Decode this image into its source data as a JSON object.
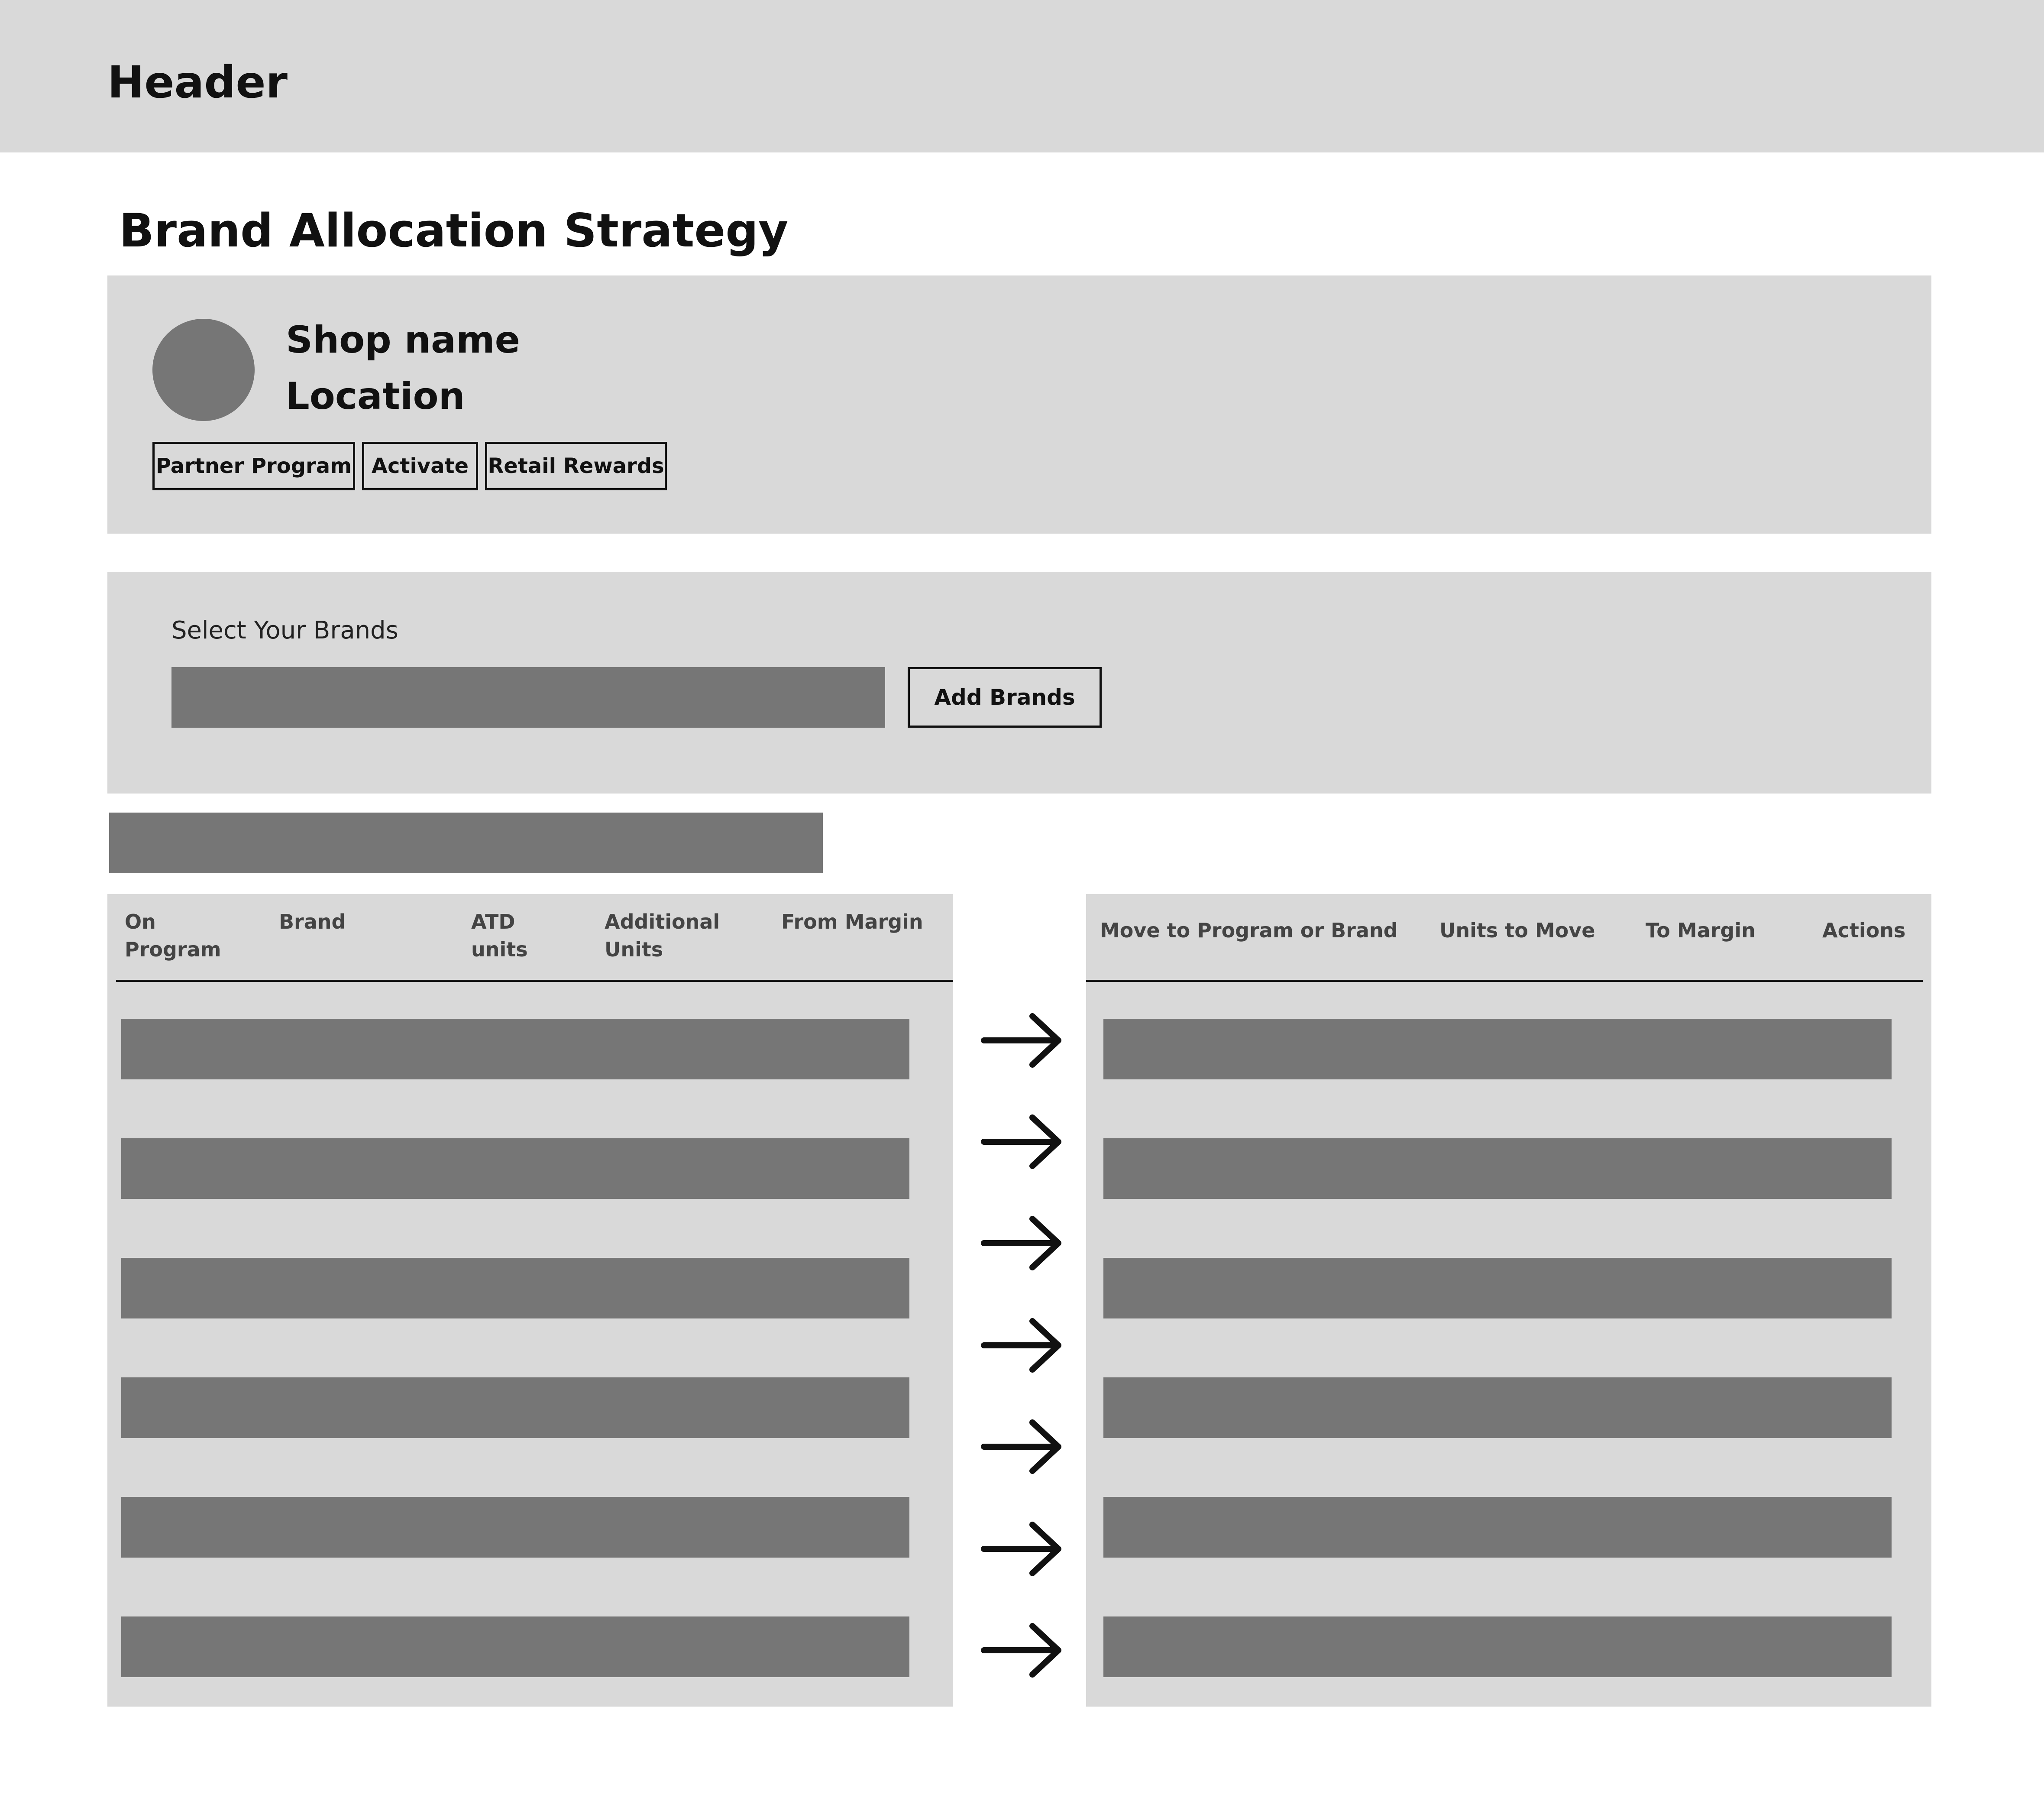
{
  "header": {
    "title": "Header"
  },
  "page": {
    "title": "Brand Allocation Strategy"
  },
  "shop": {
    "name": "Shop name",
    "location": "Location",
    "tags": [
      "Partner Program",
      "Activate",
      "Retail Rewards"
    ]
  },
  "brands": {
    "label": "Select Your Brands",
    "input_value": "",
    "add_button": "Add Brands"
  },
  "table_left": {
    "columns": [
      {
        "line1": "On",
        "line2": "Program"
      },
      {
        "line1": "Brand",
        "line2": ""
      },
      {
        "line1": "ATD",
        "line2": "units"
      },
      {
        "line1": "Additional",
        "line2": "Units"
      },
      {
        "line1": "From Margin",
        "line2": ""
      }
    ]
  },
  "table_right": {
    "columns": [
      "Move to Program or Brand",
      "Units to Move",
      "To Margin",
      "Actions"
    ]
  },
  "icons": {
    "row_arrow": "arrow-right-icon",
    "avatar": "avatar-placeholder"
  },
  "colors": {
    "panel": "#d9d9d9",
    "placeholder": "#767676",
    "text": "#111111"
  }
}
